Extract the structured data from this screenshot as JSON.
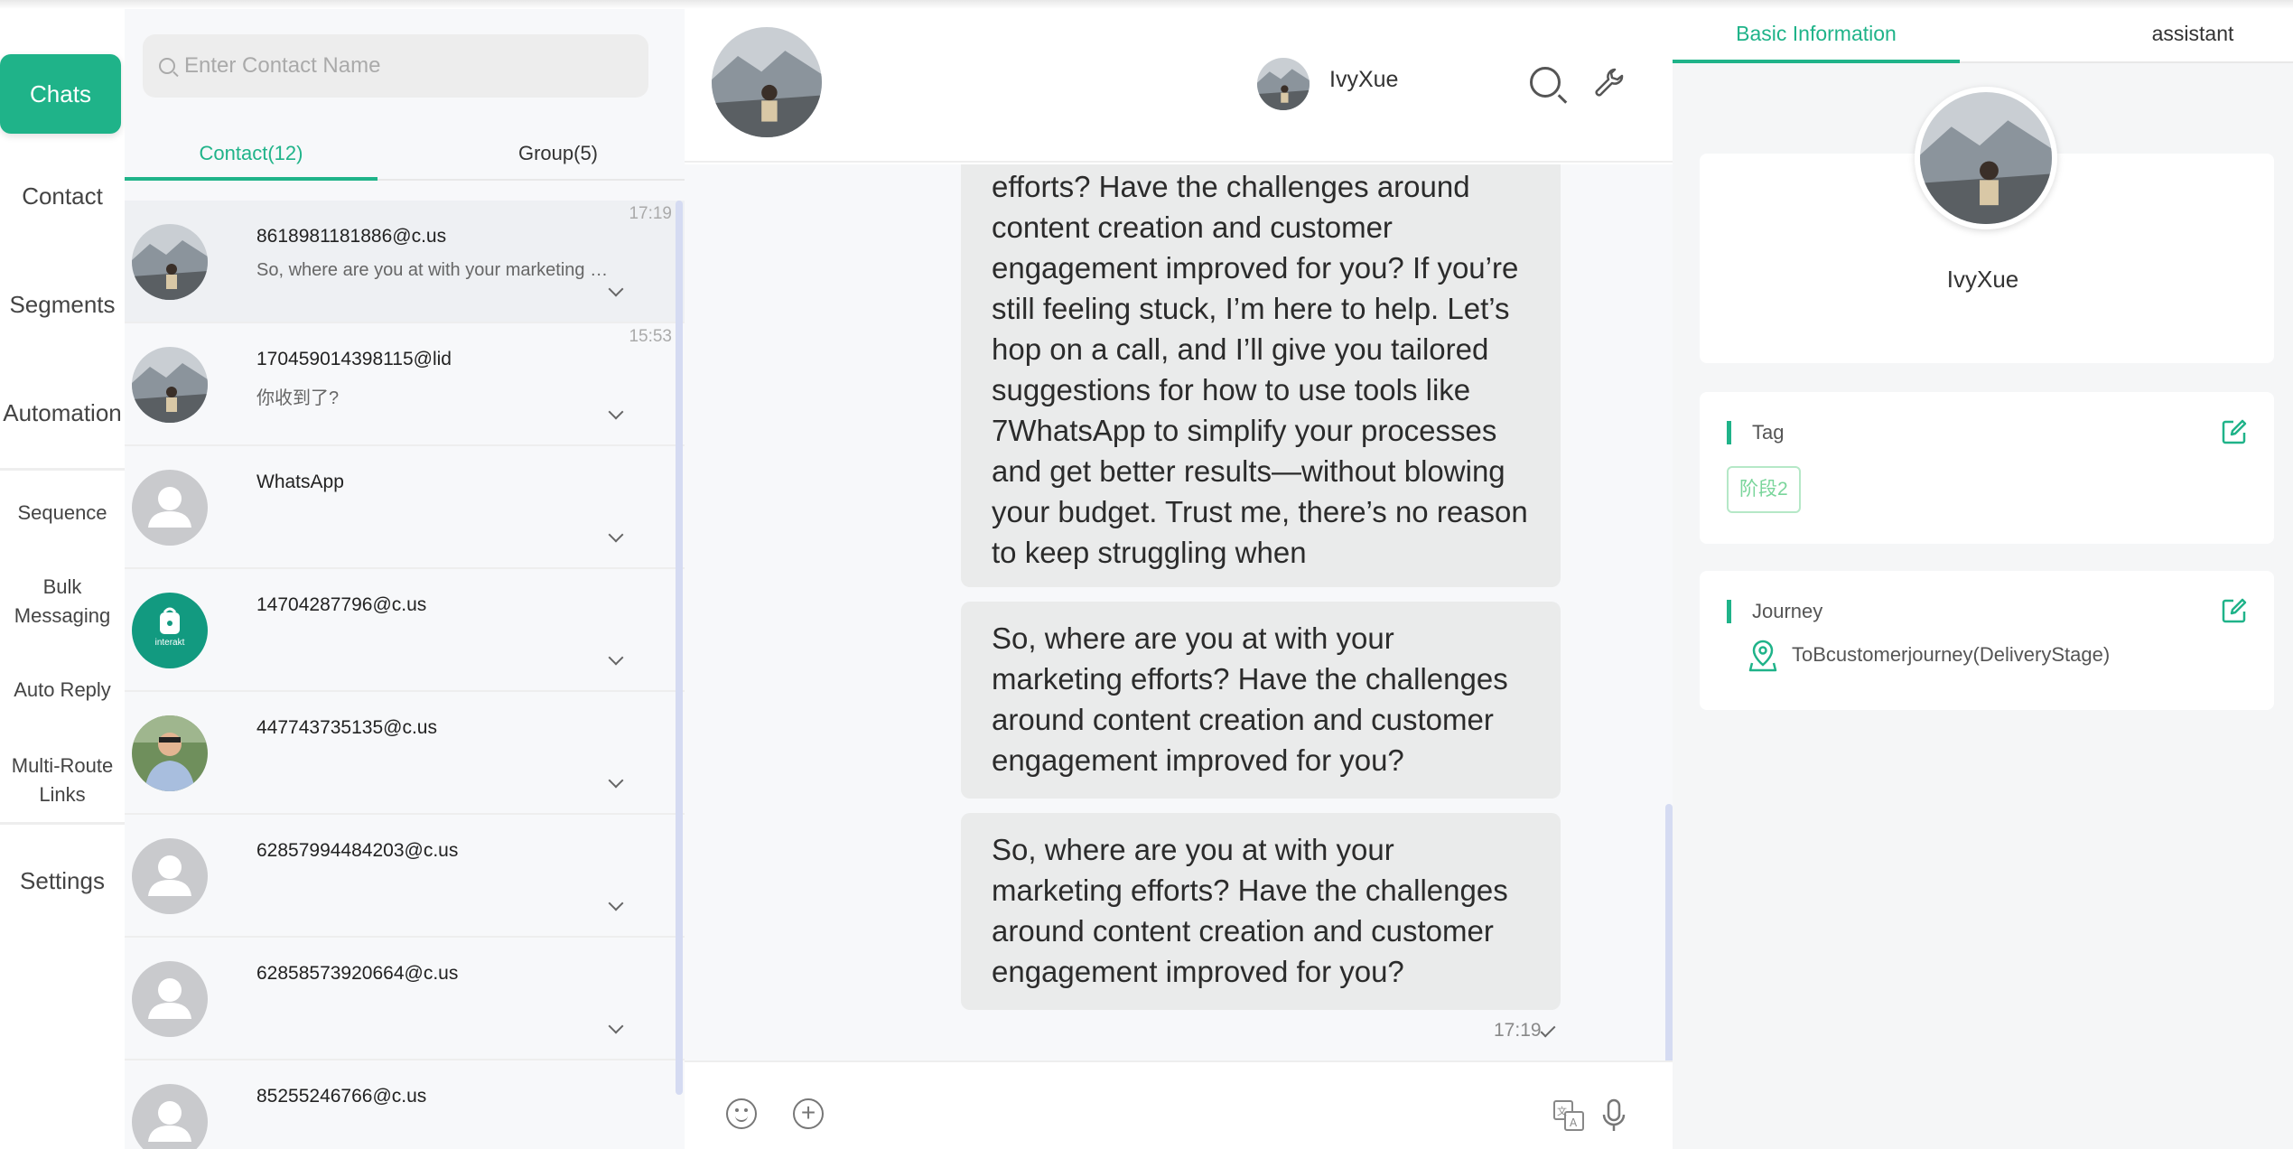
{
  "nav": {
    "chats": "Chats",
    "contact": "Contact",
    "segments": "Segments",
    "automation": "Automation",
    "sequence": "Sequence",
    "bulk_messaging_1": "Bulk",
    "bulk_messaging_2": "Messaging",
    "auto_reply": "Auto Reply",
    "multi_route_1": "Multi-Route",
    "multi_route_2": "Links",
    "settings": "Settings"
  },
  "contacts": {
    "search_placeholder": "Enter Contact Name",
    "tabs": {
      "contact": "Contact(12)",
      "group": "Group(5)"
    },
    "items": [
      {
        "name": "8618981181886@c.us",
        "message": "So, where are you at with your marketing efforts?",
        "time": "17:19",
        "avatar": "landscape-photo"
      },
      {
        "name": "170459014398115@lid",
        "message": "你收到了?",
        "time": "15:53",
        "avatar": "landscape-photo"
      },
      {
        "name": "WhatsApp",
        "message": "",
        "time": "",
        "avatar": "default-user"
      },
      {
        "name": "14704287796@c.us",
        "message": "",
        "time": "",
        "avatar": "interakt-logo"
      },
      {
        "name": "447743735135@c.us",
        "message": "",
        "time": "",
        "avatar": "person-photo"
      },
      {
        "name": "62857994484203@c.us",
        "message": "",
        "time": "",
        "avatar": "default-user"
      },
      {
        "name": "62858573920664@c.us",
        "message": "",
        "time": "",
        "avatar": "default-user"
      },
      {
        "name": "85255246766@c.us",
        "message": "",
        "time": "",
        "avatar": "default-user"
      }
    ],
    "interakt_label": "interakt"
  },
  "chat": {
    "contact_name": "IvyXue",
    "messages": [
      "efforts? Have the challenges around content creation and customer engagement improved for you? If you’re still feeling stuck, I’m here to help. Let’s hop on a call, and I’ll give you tailored suggestions for how to use tools like 7WhatsApp to simplify your processes and get better results—without blowing your budget. Trust me, there’s no reason to keep struggling when",
      "So, where are you at with your marketing efforts? Have the challenges around content creation and customer engagement improved for you?",
      "So, where are you at with your marketing efforts? Have the challenges around content creation and customer engagement improved for you?"
    ],
    "last_time": "17:19"
  },
  "right": {
    "tabs": {
      "basic": "Basic Information",
      "assistant": "assistant"
    },
    "profile_name": "IvyXue",
    "tag_title": "Tag",
    "tag_value": "阶段2",
    "journey_title": "Journey",
    "journey_value": "ToBcustomerjourney(DeliveryStage)"
  },
  "colors": {
    "accent": "#1fb389",
    "bubble": "#eaebeb",
    "panel": "#f7f8fa"
  }
}
